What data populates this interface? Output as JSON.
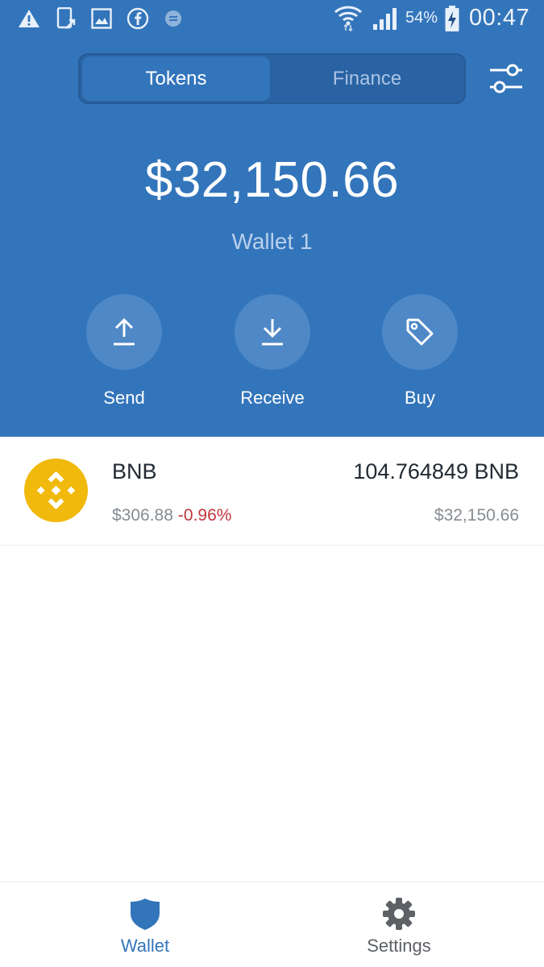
{
  "colors": {
    "header_blue": "#3375bb",
    "accent_blue": "#3375bb",
    "negative_red": "#c0363b",
    "bnb_yellow": "#f0b90b"
  },
  "status_bar": {
    "icons": [
      "warning-icon",
      "phone-upload-icon",
      "image-icon",
      "facebook-icon",
      "message-icon",
      "wifi-icon",
      "signal-icon",
      "battery-charging-icon"
    ],
    "battery_percent": "54%",
    "time": "00:47"
  },
  "tabs": [
    {
      "label": "Tokens",
      "active": true
    },
    {
      "label": "Finance",
      "active": false
    }
  ],
  "filter_icon": "sliders-icon",
  "balance": "$32,150.66",
  "wallet_name": "Wallet 1",
  "actions": [
    {
      "label": "Send",
      "icon": "upload-arrow-icon"
    },
    {
      "label": "Receive",
      "icon": "download-arrow-icon"
    },
    {
      "label": "Buy",
      "icon": "price-tag-icon"
    }
  ],
  "tokens": [
    {
      "symbol": "BNB",
      "price": "$306.88",
      "change": "-0.96%",
      "amount": "104.764849 BNB",
      "value": "$32,150.66",
      "icon": "bnb-logo-icon"
    }
  ],
  "bottom_nav": [
    {
      "label": "Wallet",
      "icon": "shield-icon",
      "active": true
    },
    {
      "label": "Settings",
      "icon": "gear-icon",
      "active": false
    }
  ]
}
